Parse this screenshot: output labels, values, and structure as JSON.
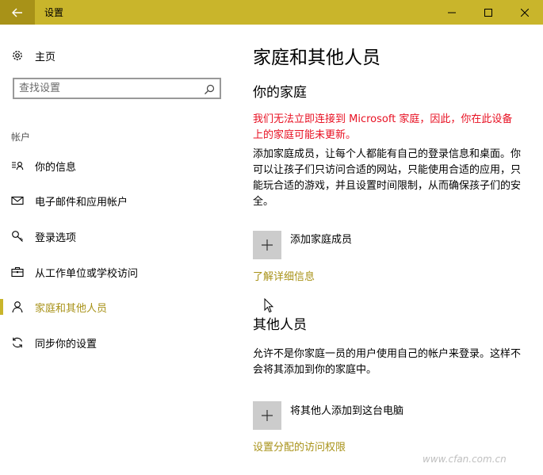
{
  "window": {
    "title": "设置"
  },
  "nav": {
    "home_label": "主页",
    "search_placeholder": "查找设置",
    "section_label": "帐户",
    "items": [
      {
        "label": "你的信息",
        "icon": "person-list-icon",
        "active": false
      },
      {
        "label": "电子邮件和应用帐户",
        "icon": "mail-icon",
        "active": false
      },
      {
        "label": "登录选项",
        "icon": "key-icon",
        "active": false
      },
      {
        "label": "从工作单位或学校访问",
        "icon": "briefcase-icon",
        "active": false
      },
      {
        "label": "家庭和其他人员",
        "icon": "person-icon",
        "active": true
      },
      {
        "label": "同步你的设置",
        "icon": "sync-icon",
        "active": false
      }
    ]
  },
  "content": {
    "page_title": "家庭和其他人员",
    "family": {
      "heading": "你的家庭",
      "error": "我们无法立即连接到 Microsoft 家庭，因此，你在此设备上的家庭可能未更新。",
      "description": "添加家庭成员，让每个人都能有自己的登录信息和桌面。你可以让孩子们只访问合适的网站，只能使用合适的应用，只能玩合适的游戏，并且设置时间限制，从而确保孩子们的安全。",
      "add_label": "添加家庭成员",
      "link": "了解详细信息"
    },
    "others": {
      "heading": "其他人员",
      "description": "允许不是你家庭一员的用户使用自己的帐户来登录。这样不会将其添加到你的家庭中。",
      "add_label": "将其他人添加到这台电脑",
      "link": "设置分配的访问权限"
    }
  },
  "watermark": "www.cfan.com.cn",
  "colors": {
    "accent": "#c9b52b",
    "accent_dark": "#a89218",
    "error": "#e81123"
  }
}
